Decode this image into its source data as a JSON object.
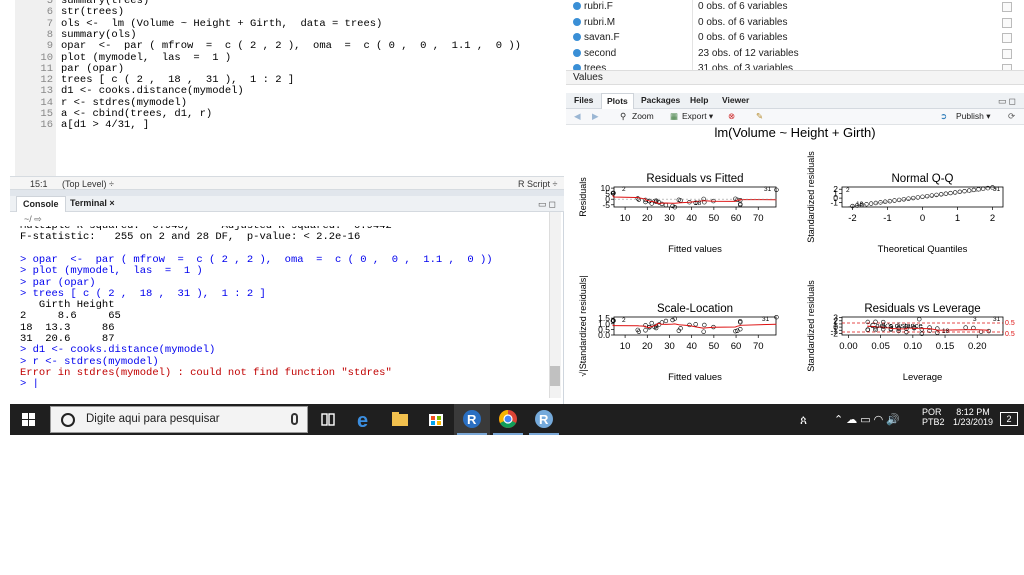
{
  "editor": {
    "lines": [
      {
        "n": "5",
        "code": "summary(trees)"
      },
      {
        "n": "6",
        "code": "str(trees)"
      },
      {
        "n": "7",
        "code": "ols <-  lm (Volume ~ Height + Girth,  data = trees)"
      },
      {
        "n": "8",
        "code": "summary(ols)"
      },
      {
        "n": "9",
        "code": "opar  <-  par ( mfrow  =  c ( 2 , 2 ),  oma  =  c ( 0 ,  0 ,  1.1 ,  0 ))"
      },
      {
        "n": "10",
        "code": "plot (mymodel,  las  =  1 )"
      },
      {
        "n": "11",
        "code": "par (opar)"
      },
      {
        "n": "12",
        "code": "trees [ c ( 2 ,  18 ,  31 ),  1 : 2 ]"
      },
      {
        "n": "13",
        "code": "d1 <- cooks.distance(mymodel)"
      },
      {
        "n": "14",
        "code": "r <- stdres(mymodel)"
      },
      {
        "n": "15",
        "code": "a <- cbind(trees, d1, r)"
      },
      {
        "n": "16",
        "code": "a[d1 > 4/31, ]"
      }
    ],
    "status": {
      "position": "15:1",
      "scope": "(Top Level) ÷",
      "filetype": "R Script ÷"
    }
  },
  "console": {
    "tabs": [
      {
        "label": "Console"
      },
      {
        "label": "Terminal ×"
      }
    ],
    "path": "~/ ⇨",
    "lines": [
      {
        "type": "out",
        "text": "Multiple R-squared:  0.948,     Adjusted R-squared:  0.9442"
      },
      {
        "type": "out",
        "text": "F-statistic:   255 on 2 and 28 DF,  p-value: < 2.2e-16"
      },
      {
        "type": "out",
        "text": ""
      },
      {
        "type": "in",
        "text": "> opar  <-  par ( mfrow  =  c ( 2 , 2 ),  oma  =  c ( 0 ,  0 ,  1.1 ,  0 ))"
      },
      {
        "type": "in",
        "text": "> plot (mymodel,  las  =  1 )"
      },
      {
        "type": "in",
        "text": "> par (opar)"
      },
      {
        "type": "in",
        "text": "> trees [ c ( 2 ,  18 ,  31 ),  1 : 2 ]"
      },
      {
        "type": "out",
        "text": "   Girth Height"
      },
      {
        "type": "out",
        "text": "2     8.6     65"
      },
      {
        "type": "out",
        "text": "18  13.3     86"
      },
      {
        "type": "out",
        "text": "31  20.6     87"
      },
      {
        "type": "in",
        "text": "> d1 <- cooks.distance(mymodel)"
      },
      {
        "type": "in",
        "text": "> r <- stdres(mymodel)"
      },
      {
        "type": "err",
        "text": "Error in stdres(mymodel) : could not find function \"stdres\""
      },
      {
        "type": "in",
        "text": "> |"
      }
    ]
  },
  "environment": {
    "rows": [
      {
        "name": "rubri.F",
        "value": "0 obs. of 6 variables"
      },
      {
        "name": "rubri.M",
        "value": "0 obs. of 6 variables"
      },
      {
        "name": "savan.F",
        "value": "0 obs. of 6 variables"
      },
      {
        "name": "second",
        "value": "23 obs. of 12 variables"
      },
      {
        "name": "trees",
        "value": "31 obs. of 3 variables"
      }
    ],
    "values_header": "Values"
  },
  "plots": {
    "tabs": [
      "Files",
      "Plots",
      "Packages",
      "Help",
      "Viewer"
    ],
    "active_tab": "Plots",
    "toolbar": {
      "zoom": "Zoom",
      "export": "Export ▾",
      "publish": "Publish ▾"
    },
    "outer_title": "lm(Volume ~ Height + Girth)"
  },
  "chart_data": [
    {
      "type": "scatter",
      "title": "Residuals vs Fitted",
      "xlabel": "Fitted values",
      "ylabel": "Residuals",
      "xlim": [
        5,
        78
      ],
      "ylim": [
        -7,
        11
      ],
      "xticks": [
        "10",
        "20",
        "30",
        "40",
        "50",
        "60",
        "70"
      ],
      "yticks": [
        "10",
        "5",
        "0",
        "-5"
      ],
      "labeled_points": [
        "2",
        "18",
        "31"
      ]
    },
    {
      "type": "scatter",
      "title": "Normal Q-Q",
      "xlabel": "Theoretical Quantiles",
      "ylabel": "Standardized residuals",
      "xlim": [
        -2.3,
        2.3
      ],
      "ylim": [
        -2,
        2.5
      ],
      "xticks": [
        "-2",
        "-1",
        "0",
        "1",
        "2"
      ],
      "yticks": [
        "2",
        "1",
        "0",
        "-1"
      ],
      "labeled_points": [
        "18",
        "2",
        "31"
      ]
    },
    {
      "type": "scatter",
      "title": "Scale-Location",
      "xlabel": "Fitted values",
      "ylabel": "√|Standardized residuals|",
      "xlim": [
        5,
        78
      ],
      "ylim": [
        0,
        1.6
      ],
      "xticks": [
        "10",
        "20",
        "30",
        "40",
        "50",
        "60",
        "70"
      ],
      "yticks": [
        "1.5",
        "1.0",
        "0.5",
        "0.0"
      ],
      "labeled_points": [
        "2",
        "31"
      ]
    },
    {
      "type": "scatter",
      "title": "Residuals vs Leverage",
      "xlabel": "Leverage",
      "ylabel": "Standardized residuals",
      "xlim": [
        -0.01,
        0.24
      ],
      "ylim": [
        -2.5,
        3.2
      ],
      "xticks": [
        "0.00",
        "0.05",
        "0.10",
        "0.15",
        "0.20"
      ],
      "yticks": [
        "3",
        "2",
        "1",
        "0",
        "-1",
        "-2"
      ],
      "labeled_points": [
        "3",
        "18",
        "31"
      ],
      "annotations": [
        "Cook's distance",
        "0.5",
        "0.5"
      ]
    }
  ],
  "taskbar": {
    "search_placeholder": "Digite aqui para pesquisar",
    "language": "POR",
    "layout": "PTB2",
    "time": "8:12 PM",
    "date": "1/23/2019",
    "notification_count": "2"
  }
}
